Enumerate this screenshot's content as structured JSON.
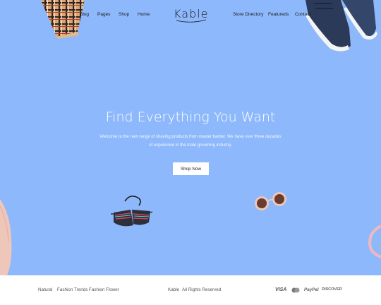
{
  "header": {
    "logo": "Kable",
    "nav_left": [
      "Blog",
      "Pages",
      "Shop",
      "Home"
    ],
    "nav_right": [
      "Store Directory",
      "Featureds",
      "Contact"
    ]
  },
  "hero": {
    "title": "Find Everything You Want",
    "description": "Welcome to the new range of shaving products from master barber. We have over three decades of experience in the male grooming industry.",
    "button_label": "Shop Now",
    "background_color": "#8db8fb"
  },
  "footer": {
    "tags": [
      "Natural",
      "Fashion Trends",
      "Fashion",
      "Flower"
    ],
    "brand": "Kable",
    "copyright": "All Rights Reserved",
    "payments": [
      "VISA",
      "PayPal",
      "DISCOVER"
    ]
  }
}
